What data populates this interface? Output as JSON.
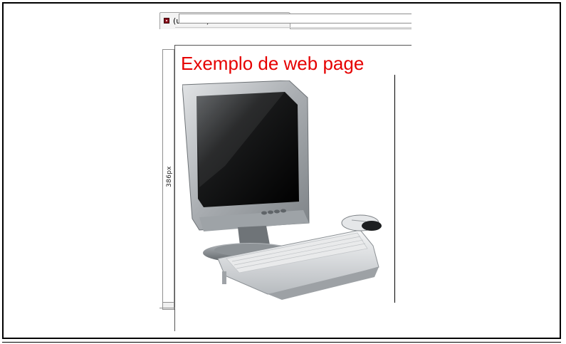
{
  "window": {
    "tab_title": "(untitled)",
    "tab_icon": "document-icon"
  },
  "ruler": {
    "height_label": "386px"
  },
  "page": {
    "heading": "Exemplo de web page",
    "heading_color": "#e60000",
    "image": "computer-image"
  }
}
